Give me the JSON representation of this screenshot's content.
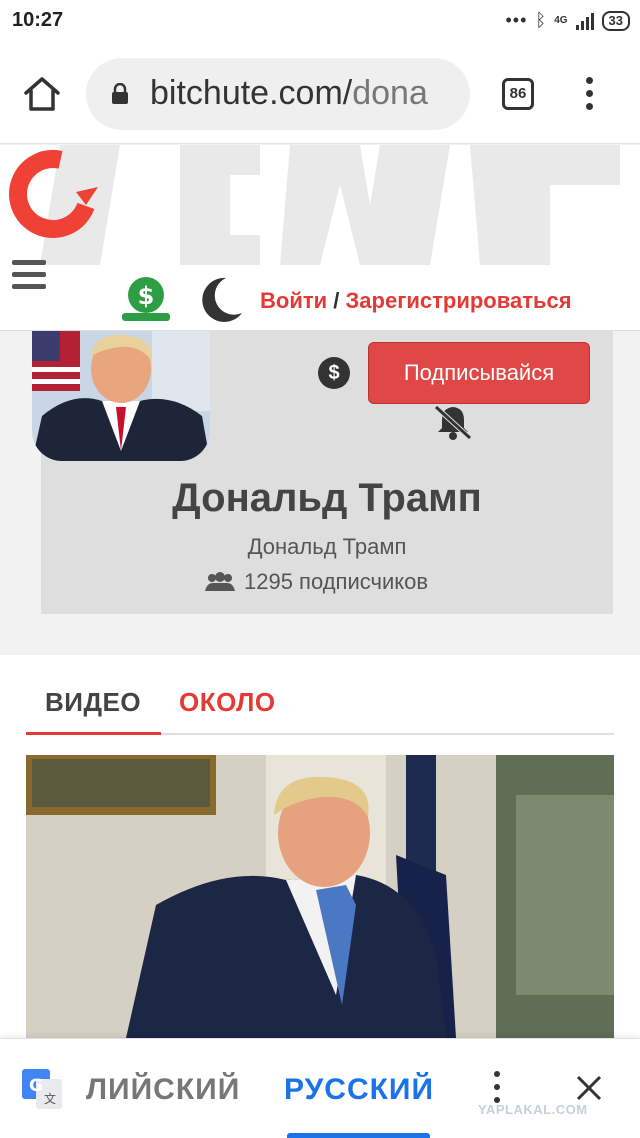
{
  "status_bar": {
    "time": "10:27",
    "network": "4G",
    "battery": "33"
  },
  "browser": {
    "url_main": "bitchute.com/",
    "url_faded": "dona",
    "tab_count": "86"
  },
  "site": {
    "auth_login": "Войти",
    "auth_separator": " / ",
    "auth_register": "Зарегистрироваться",
    "brand_color": "#e53935"
  },
  "channel": {
    "subscribe_dollar": "$",
    "subscribe_label": "Подписывайся",
    "name": "Дональд Трамп",
    "subtitle": "Дональд Трамп",
    "subscribers": "1295 подписчиков"
  },
  "tabs": [
    {
      "label": "ВИДЕО",
      "active": true
    },
    {
      "label": "ОКОЛО",
      "active": false
    }
  ],
  "translate_bar": {
    "source_lang": "ЛИЙСКИЙ",
    "target_lang": "РУССКИЙ",
    "accent": "#1a73e8"
  },
  "watermark": "YAPLAKAL.COM",
  "icons": [
    "home-icon",
    "lock-icon",
    "more-vert-icon",
    "menu-icon",
    "donate-icon",
    "moon-icon",
    "dollar-icon",
    "bell-off-icon",
    "users-icon",
    "google-translate-icon",
    "close-icon"
  ]
}
